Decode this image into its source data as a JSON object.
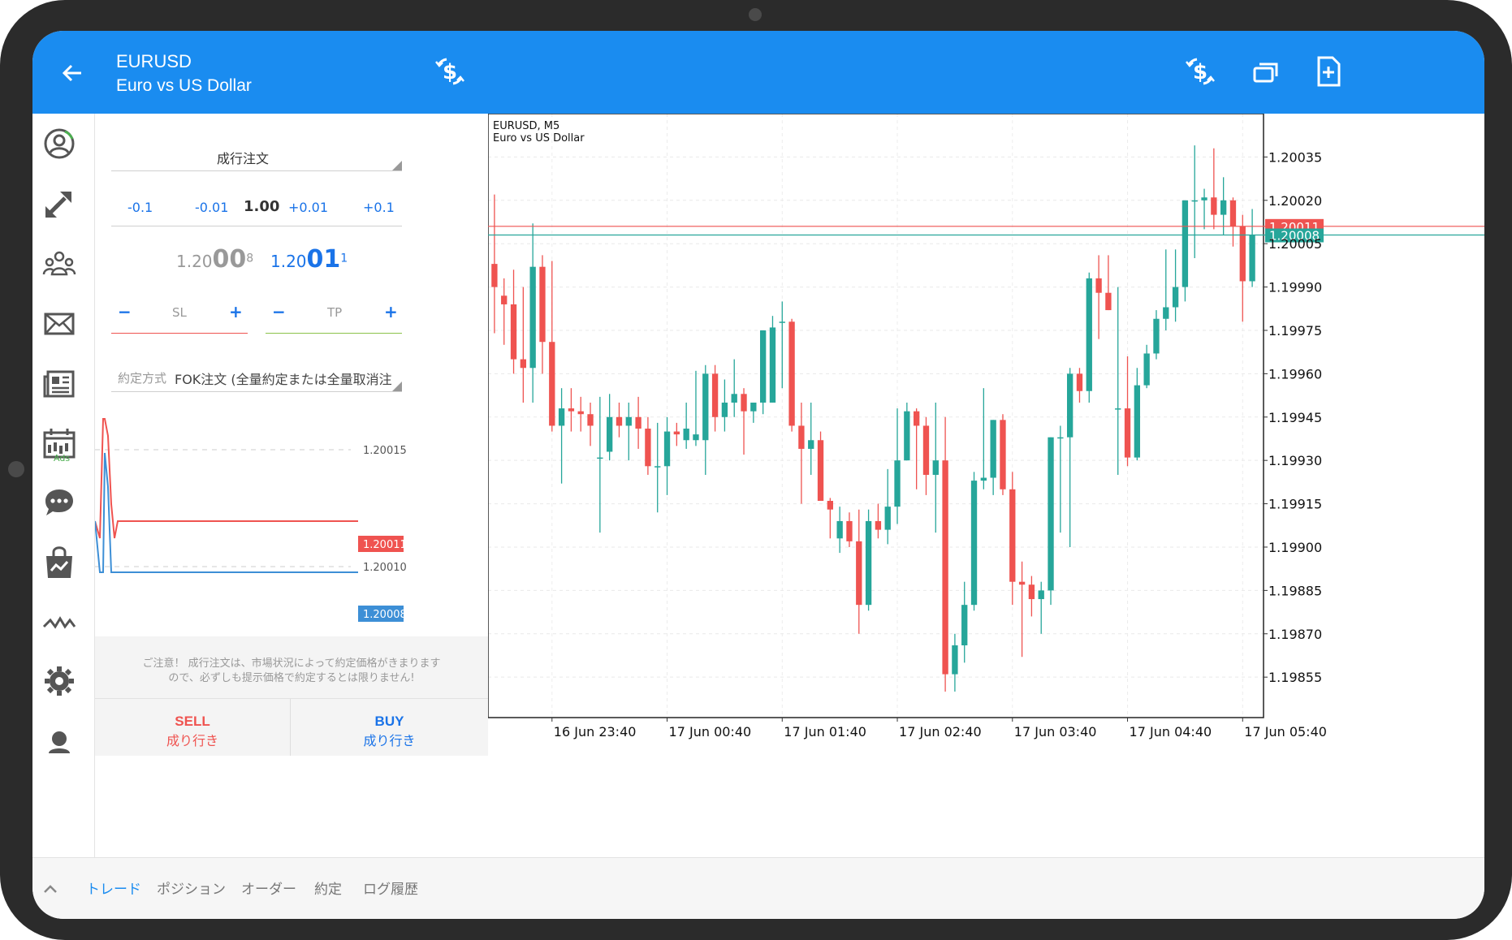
{
  "header": {
    "symbol": "EURUSD",
    "description": "Euro vs US Dollar",
    "icons": [
      "arrow-left-icon",
      "dollar-exchange-icon",
      "dollar-exchange-icon",
      "windows-icon",
      "document-add-icon"
    ]
  },
  "sidebar": {
    "items": [
      "account-icon",
      "trade-icon",
      "community-icon",
      "mail-icon",
      "news-icon",
      "economic-calendar-icon",
      "chat-icon",
      "market-icon",
      "signals-icon",
      "settings-icon",
      "support-icon"
    ],
    "ads_label": "Ads"
  },
  "order": {
    "type_label": "成行注文",
    "volume_steps": [
      "-0.1",
      "-0.01",
      "+0.01",
      "+0.1"
    ],
    "volume": "1.00",
    "bid": {
      "prefix": "1.20",
      "big": "00",
      "sup": "8"
    },
    "ask": {
      "prefix": "1.20",
      "big": "01",
      "sup": "1"
    },
    "sl_label": "SL",
    "tp_label": "TP",
    "minus": "−",
    "plus": "+",
    "filling_label": "約定方式",
    "filling_value": "FOK注文 (全量約定または全量取消注...",
    "tick_levels": [
      "1.20015",
      "1.20010"
    ],
    "tick_ask": "1.20011",
    "tick_bid": "1.20008",
    "warning_line1": "ご注意！ 成行注文は、市場状況によって約定価格がきまります",
    "warning_line2": "ので、必ずしも提示価格で約定するとは限りません!",
    "sell_label": "SELL",
    "sell_sub": "成り行き",
    "buy_label": "BUY",
    "buy_sub": "成り行き"
  },
  "chart_data": {
    "type": "candlestick",
    "title": "EURUSD, M5",
    "subtitle": "Euro vs US Dollar",
    "price_ticks": [
      "1.20035",
      "1.20020",
      "1.20005",
      "1.19990",
      "1.19975",
      "1.19960",
      "1.19945",
      "1.19930",
      "1.19915",
      "1.19900",
      "1.19885",
      "1.19870",
      "1.19855"
    ],
    "time_labels": [
      "16 Jun 23:40",
      "17 Jun 00:40",
      "17 Jun 01:40",
      "17 Jun 02:40",
      "17 Jun 03:40",
      "17 Jun 04:40",
      "17 Jun 05:40"
    ],
    "ylim": [
      1.19841,
      1.2005
    ],
    "ask_line": 1.20011,
    "bid_line": 1.20008,
    "ask_label": "1.20011",
    "bid_label": "1.20008",
    "colors": {
      "up": "#26a69a",
      "down": "#ef5350"
    },
    "candles": [
      [
        1.19998,
        1.20022,
        1.19974,
        1.1999
      ],
      [
        1.19987,
        1.19993,
        1.1997,
        1.19984
      ],
      [
        1.19984,
        1.19996,
        1.1996,
        1.19965
      ],
      [
        1.19965,
        1.1999,
        1.1995,
        1.19962
      ],
      [
        1.19962,
        1.20012,
        1.1995,
        1.19997
      ],
      [
        1.19997,
        1.20001,
        1.1996,
        1.19971
      ],
      [
        1.19971,
        1.19999,
        1.1994,
        1.19942
      ],
      [
        1.19942,
        1.19955,
        1.19922,
        1.19948
      ],
      [
        1.19948,
        1.19955,
        1.1994,
        1.19947
      ],
      [
        1.19947,
        1.19952,
        1.1994,
        1.19946
      ],
      [
        1.19946,
        1.1995,
        1.19935,
        1.19942
      ],
      [
        1.19931,
        1.19952,
        1.19905,
        1.19931
      ],
      [
        1.19933,
        1.19953,
        1.1993,
        1.19945
      ],
      [
        1.19945,
        1.1995,
        1.19938,
        1.19942
      ],
      [
        1.19942,
        1.1995,
        1.1993,
        1.19945
      ],
      [
        1.19945,
        1.19952,
        1.19934,
        1.19941
      ],
      [
        1.19941,
        1.19945,
        1.19925,
        1.19928
      ],
      [
        1.19928,
        1.19943,
        1.19912,
        1.19928
      ],
      [
        1.19928,
        1.19945,
        1.19918,
        1.1994
      ],
      [
        1.1994,
        1.19943,
        1.19935,
        1.19939
      ],
      [
        1.19937,
        1.1995,
        1.19934,
        1.19941
      ],
      [
        1.19937,
        1.19961,
        1.19935,
        1.19939
      ],
      [
        1.19937,
        1.19963,
        1.19925,
        1.1996
      ],
      [
        1.1996,
        1.19963,
        1.1994,
        1.19945
      ],
      [
        1.19945,
        1.19958,
        1.1994,
        1.1995
      ],
      [
        1.1995,
        1.19965,
        1.19945,
        1.19953
      ],
      [
        1.19953,
        1.19955,
        1.19932,
        1.19947
      ],
      [
        1.19947,
        1.1995,
        1.19943,
        1.1995
      ],
      [
        1.1995,
        1.19962,
        1.19946,
        1.19975
      ],
      [
        1.1995,
        1.1998,
        1.1995,
        1.19976
      ],
      [
        1.19978,
        1.19985,
        1.19955,
        1.19978
      ],
      [
        1.19978,
        1.19979,
        1.1994,
        1.19942
      ],
      [
        1.19942,
        1.1995,
        1.19915,
        1.19934
      ],
      [
        1.19934,
        1.1995,
        1.19925,
        1.19937
      ],
      [
        1.19937,
        1.1994,
        1.19916,
        1.19916
      ],
      [
        1.19916,
        1.19917,
        1.19903,
        1.19913
      ],
      [
        1.19903,
        1.19914,
        1.19898,
        1.19909
      ],
      [
        1.19909,
        1.19912,
        1.199,
        1.19902
      ],
      [
        1.19902,
        1.19913,
        1.1987,
        1.1988
      ],
      [
        1.1988,
        1.19913,
        1.19878,
        1.19909
      ],
      [
        1.19909,
        1.19915,
        1.19903,
        1.19906
      ],
      [
        1.19906,
        1.19927,
        1.19901,
        1.19914
      ],
      [
        1.19914,
        1.19948,
        1.19908,
        1.1993
      ],
      [
        1.1993,
        1.1995,
        1.1993,
        1.19947
      ],
      [
        1.19947,
        1.19948,
        1.1992,
        1.19942
      ],
      [
        1.19942,
        1.19945,
        1.19918,
        1.19925
      ],
      [
        1.19925,
        1.1995,
        1.19905,
        1.1993
      ],
      [
        1.1993,
        1.19945,
        1.1985,
        1.19856
      ],
      [
        1.19856,
        1.1987,
        1.1985,
        1.19866
      ],
      [
        1.19866,
        1.19888,
        1.1986,
        1.1988
      ],
      [
        1.1988,
        1.19926,
        1.19878,
        1.19923
      ],
      [
        1.19923,
        1.19955,
        1.1992,
        1.19924
      ],
      [
        1.19924,
        1.19944,
        1.19918,
        1.19944
      ],
      [
        1.19944,
        1.19946,
        1.19918,
        1.1992
      ],
      [
        1.1992,
        1.19926,
        1.1988,
        1.19888
      ],
      [
        1.19888,
        1.19895,
        1.19862,
        1.19887
      ],
      [
        1.19887,
        1.1989,
        1.19876,
        1.19882
      ],
      [
        1.19882,
        1.19888,
        1.1987,
        1.19885
      ],
      [
        1.19885,
        1.19938,
        1.1988,
        1.19938
      ],
      [
        1.19938,
        1.19942,
        1.19905,
        1.19938
      ],
      [
        1.19938,
        1.19962,
        1.199,
        1.1996
      ],
      [
        1.1996,
        1.19962,
        1.1995,
        1.19954
      ],
      [
        1.19954,
        1.19995,
        1.1995,
        1.19993
      ],
      [
        1.19993,
        1.20001,
        1.19972,
        1.19988
      ],
      [
        1.19988,
        1.20001,
        1.19982,
        1.19982
      ],
      [
        1.19948,
        1.1999,
        1.19925,
        1.19948
      ],
      [
        1.19948,
        1.19966,
        1.19928,
        1.19931
      ],
      [
        1.19931,
        1.19962,
        1.1993,
        1.19956
      ],
      [
        1.19956,
        1.1997,
        1.19955,
        1.19967
      ],
      [
        1.19967,
        1.19982,
        1.19965,
        1.19979
      ],
      [
        1.19979,
        1.20003,
        1.19975,
        1.19983
      ],
      [
        1.19983,
        1.20003,
        1.19978,
        1.1999
      ],
      [
        1.1999,
        1.20019,
        1.19985,
        1.2002
      ],
      [
        1.2002,
        1.20039,
        1.2,
        1.2002
      ],
      [
        1.2002,
        1.20024,
        1.2001,
        1.20021
      ],
      [
        1.20021,
        1.20038,
        1.2001,
        1.20015
      ],
      [
        1.20015,
        1.20028,
        1.20008,
        1.2002
      ],
      [
        1.2002,
        1.20021,
        1.20004,
        1.20011
      ],
      [
        1.20011,
        1.20015,
        1.19978,
        1.19992
      ],
      [
        1.19992,
        1.20017,
        1.1999,
        1.20008
      ]
    ]
  },
  "tick_chart_data": {
    "type": "line",
    "ylim": [
      1.20005,
      1.20017
    ],
    "series": [
      {
        "name": "",
        "color": "#ef5350",
        "values": [
          1.20011,
          1.2001,
          1.20017,
          1.20017,
          1.20016,
          1.20012,
          1.2001,
          1.20011,
          1.20011,
          1.20011,
          1.20011
        ]
      },
      {
        "name": "",
        "color": "#3d8fd6",
        "values": [
          1.20011,
          1.20008,
          1.20008,
          1.20015,
          1.20013,
          1.20008,
          1.20008,
          1.20008,
          1.20008,
          1.20008,
          1.20008
        ]
      }
    ]
  },
  "bottom_tabs": [
    "トレード",
    "ポジション",
    "オーダー",
    "約定",
    "ログ履歴"
  ]
}
